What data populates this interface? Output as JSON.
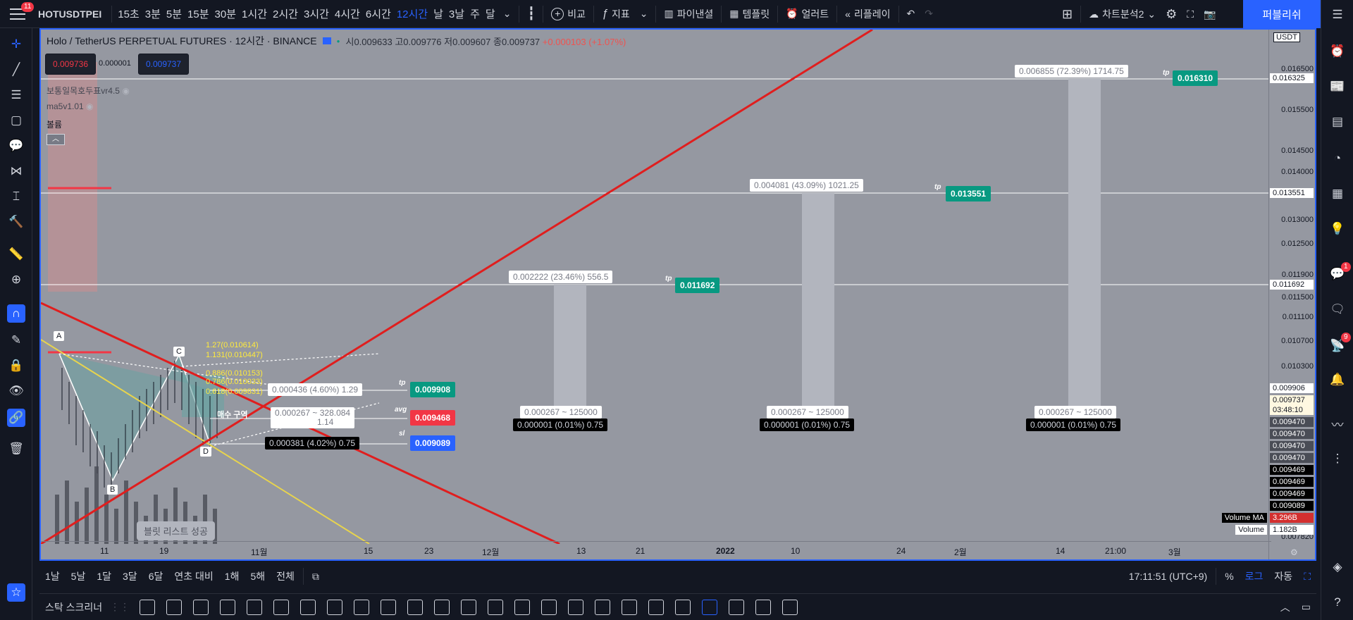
{
  "topbar": {
    "symbol": "HOTUSDTPEI",
    "notif_count": "11",
    "intervals": [
      "15초",
      "3분",
      "5분",
      "15분",
      "30분",
      "1시간",
      "2시간",
      "3시간",
      "4시간",
      "6시간",
      "12시간",
      "날",
      "3날",
      "주",
      "달"
    ],
    "active_interval": "12시간",
    "compare": "비교",
    "indicators": "지표",
    "financials": "파이낸셜",
    "templates": "템플릿",
    "alert": "얼러트",
    "replay": "리플레이",
    "layout_name": "차트분석2",
    "publish": "퍼블리쉬"
  },
  "legend": {
    "title": "Holo / TetherUS PERPETUAL FUTURES · 12시간 · BINANCE",
    "o_label": "시",
    "o": "0.009633",
    "h_label": "고",
    "h": "0.009776",
    "l_label": "저",
    "l": "0.009607",
    "c_label": "종",
    "c": "0.009737",
    "change": "+0.000103 (+1.07%)",
    "sell_price": "0.009736",
    "spread": "0.000001",
    "buy_price": "0.009737",
    "ind1": "보통일목호두표vr4.5",
    "ind2": "ma5v1.01",
    "ind3": "볼륨"
  },
  "labels": {
    "tp3_info": "0.006855 (72.39%) 1714.75",
    "tp3": "0.016310",
    "tp2_info": "0.004081 (43.09%) 1021.25",
    "tp2": "0.013551",
    "tp1_info": "0.002222 (23.46%) 556.5",
    "tp1": "0.011692",
    "tp0_info": "0.000436 (4.60%) 1.29",
    "tp0": "0.009908",
    "avg_info": "0.000267 ~ 328.084",
    "avg_sub": "1.14",
    "avg": "0.009468",
    "sl_info": "0.000381 (4.02%) 0.75",
    "sl": "0.009089",
    "tp_tag": "tp",
    "avg_tag": "avg",
    "sl_tag": "sl",
    "range_a": "0.000267 ~ 125000",
    "range_b": "0.000001 (0.01%) 0.75",
    "fib_127": "1.27(0.010614)",
    "fib_1131": "1.131(0.010447)",
    "fib_0886": "0.886(0.010153)",
    "fib_0786": "0.786(0.010033)",
    "fib_0618": "0.618(0.009831)",
    "pt_a": "A",
    "pt_b": "B",
    "pt_c": "C",
    "pt_d": "D",
    "korean_note": "매수 구역",
    "toast": "블릿 리스트 성공"
  },
  "axis": {
    "currency": "USDT",
    "ticks": [
      "0.016500",
      "0.015500",
      "0.014500",
      "0.014000",
      "0.013000",
      "0.012500",
      "0.011900",
      "0.011500",
      "0.011100",
      "0.010700",
      "0.010300",
      "0.007820"
    ],
    "boxes_white": [
      "0.016325",
      "0.013551",
      "0.011692",
      "0.009906"
    ],
    "box_cur": "0.009737",
    "box_cnt": "03:48:10",
    "boxes_black": [
      "0.009470",
      "0.009470",
      "0.009470",
      "0.009470",
      "0.009469",
      "0.009469",
      "0.009469",
      "0.009089"
    ],
    "vol_ma_label": "Volume MA",
    "vol_ma": "3.296B",
    "vol_label": "Volume",
    "vol": "1.182B"
  },
  "time_axis": [
    "11",
    "19",
    "11월",
    "15",
    "23",
    "12월",
    "13",
    "21",
    "2022",
    "10",
    "24",
    "2월",
    "14",
    "21:00",
    "3월"
  ],
  "bottom": {
    "ranges": [
      "1날",
      "5날",
      "1달",
      "3달",
      "6달",
      "연초 대비",
      "1해",
      "5해",
      "전체"
    ],
    "clock": "17:11:51 (UTC+9)",
    "pct": "%",
    "log": "로그",
    "auto": "자동",
    "script_tab": "스탁 스크리너"
  },
  "chat_badge": "1",
  "ideas_badge": "9"
}
